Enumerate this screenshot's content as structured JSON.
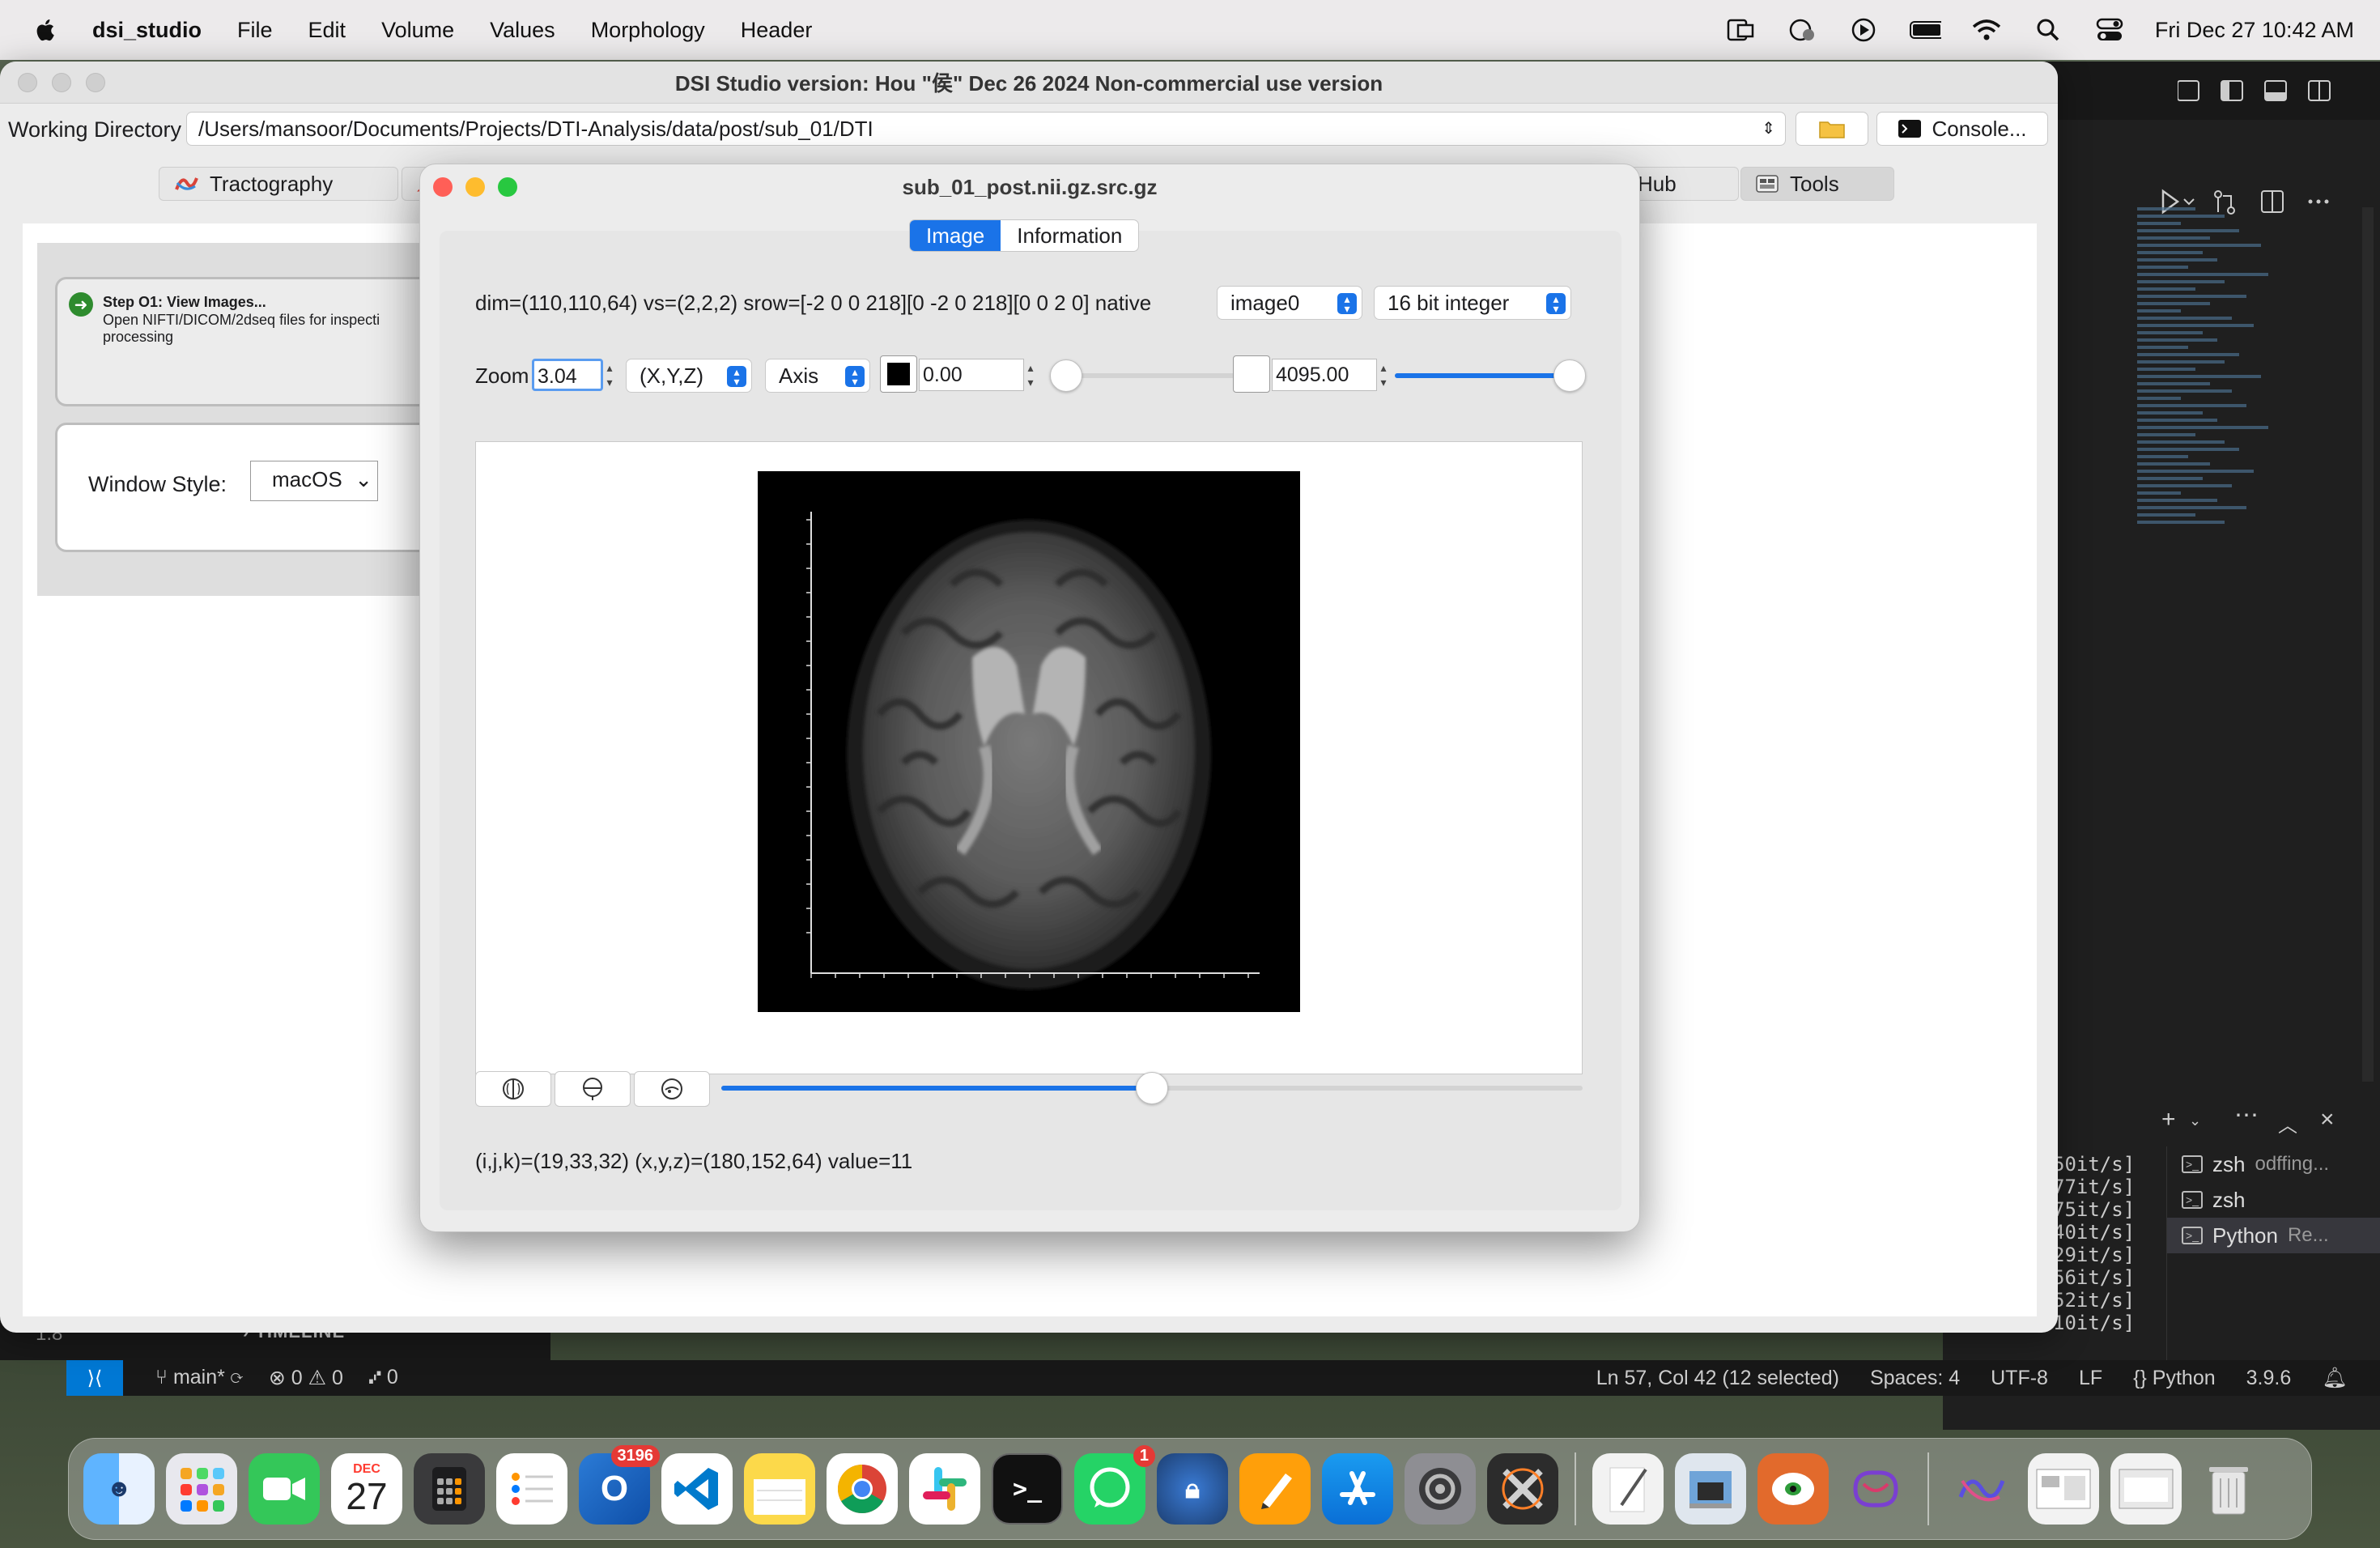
{
  "menubar": {
    "app_name": "dsi_studio",
    "items": [
      "File",
      "Edit",
      "Volume",
      "Values",
      "Morphology",
      "Header"
    ],
    "clock": "Fri Dec 27  10:42 AM"
  },
  "main_window": {
    "title": "DSI Studio version: Hou \"侯\" Dec 26 2024 Non-commercial use version",
    "working_directory_label": "Working Directory",
    "working_directory_value": "/Users/mansoor/Documents/Projects/DTI-Analysis/data/post/sub_01/DTI",
    "console_button": "Console...",
    "tabs": {
      "tractography": "Tractography",
      "hub": "Hub",
      "tools": "Tools"
    },
    "step1_title": "Step O1: View Images...",
    "step1_desc": "Open NIFTI/DICOM/2dseq files for inspecti processing",
    "window_style_label": "Window Style:",
    "window_style_value": "macOS"
  },
  "dialog": {
    "title": "sub_01_post.nii.gz.src.gz",
    "tabs": {
      "image": "Image",
      "information": "Information"
    },
    "dim_info": "dim=(110,110,64) vs=(2,2,2) srow=[-2 0 0 218][0 -2 0 218][0 0 2 0] native",
    "image_select": "image0",
    "type_select": "16 bit integer",
    "zoom_label": "Zoom",
    "zoom_value": "3.04",
    "orientation": "(X,Y,Z)",
    "axis": "Axis",
    "min_value": "0.00",
    "max_value": "4095.00",
    "contrast_min_fraction": 0.0,
    "contrast_max_fraction": 1.0,
    "slice_fraction": 0.5,
    "coord_text": "(i,j,k)=(19,33,32) (x,y,z)=(180,152,64) value=11"
  },
  "vscode": {
    "terminal_output": [
      "50it/s]",
      "77it/s]",
      "75it/s]",
      "40it/s]",
      "29it/s]",
      "56it/s]",
      "52it/s]",
      "10it/s]"
    ],
    "terminals": [
      {
        "name": "zsh",
        "detail": "odffing..."
      },
      {
        "name": "zsh",
        "detail": ""
      },
      {
        "name": "Python",
        "detail": "Re..."
      }
    ],
    "timeline": "TIMELINE",
    "version_fragment": "1.8",
    "status_left": {
      "branch": "main*",
      "errors": "0",
      "warnings": "0",
      "ports": "0"
    },
    "status_right": {
      "position": "Ln 57, Col 42 (12 selected)",
      "spaces": "Spaces: 4",
      "encoding": "UTF-8",
      "eol": "LF",
      "language": "Python",
      "version": "3.9.6"
    }
  },
  "dock": {
    "calendar_month": "DEC",
    "calendar_day": "27",
    "outlook_badge": "3196",
    "whatsapp_badge": "1"
  },
  "colors": {
    "accent": "#1a73e8",
    "close": "#ff5f57",
    "minimize": "#febc2e",
    "zoom": "#28c840"
  }
}
